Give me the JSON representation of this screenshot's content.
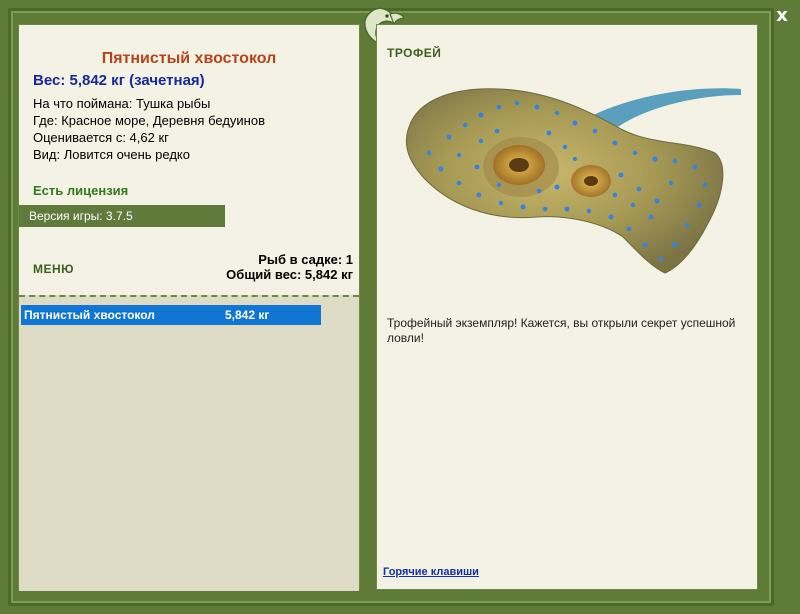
{
  "header": {
    "close_label": "x"
  },
  "fish": {
    "name": "Пятнистый хвостокол",
    "weight_line": "Вес: 5,842 кг (зачетная)",
    "info": [
      "На что поймана: Тушка рыбы",
      "Где: Красное море, Деревня бедуинов",
      "Оценивается с: 4,62 кг",
      "Вид: Ловится очень редко"
    ]
  },
  "license": "Есть лицензия",
  "version": "Версия игры: 3.7.5",
  "menu_label": "МЕНЮ",
  "counts": {
    "fish_in_keepnet": "Рыб в садке: 1",
    "total_weight": "Общий вес: 5,842 кг"
  },
  "keepnet": [
    {
      "name": "Пятнистый хвостокол",
      "weight": "5,842 кг"
    }
  ],
  "trophy": {
    "label": "ТРОФЕЙ",
    "text": "Трофейный экземпляр! Кажется, вы открыли секрет успешной ловли!"
  },
  "hotkeys_label": "Горячие клавиши",
  "colors": {
    "frame": "#5e7c38",
    "panel": "#f4f2e4",
    "title": "#b5441b",
    "weight": "#17289a",
    "selection": "#1176d3"
  }
}
